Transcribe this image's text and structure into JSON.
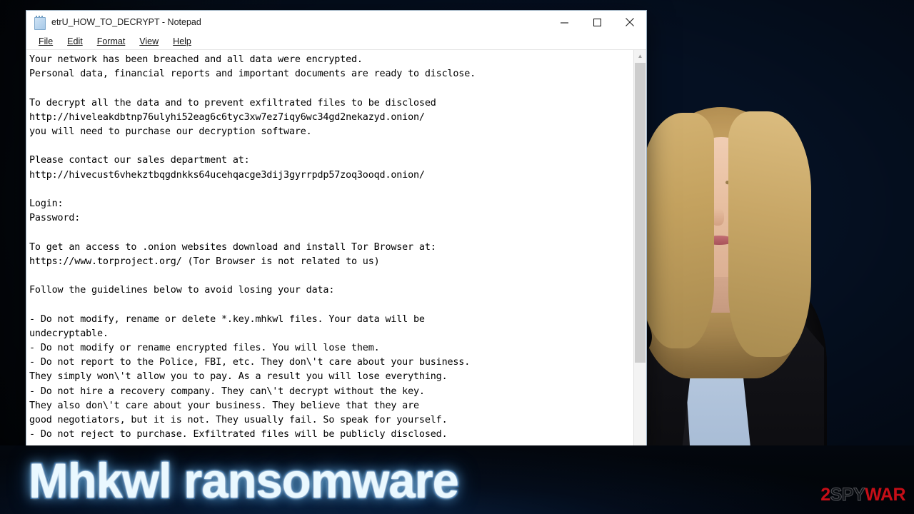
{
  "window": {
    "title": "etrU_HOW_TO_DECRYPT - Notepad",
    "icon": "notepad-icon",
    "menu": [
      {
        "label": "File",
        "accel": "F"
      },
      {
        "label": "Edit",
        "accel": "E"
      },
      {
        "label": "Format",
        "accel": "o"
      },
      {
        "label": "View",
        "accel": "V"
      },
      {
        "label": "Help",
        "accel": "H"
      }
    ],
    "controls": {
      "minimize": "minimize-button",
      "maximize": "maximize-button",
      "close": "close-button"
    },
    "note_text": "Your network has been breached and all data were encrypted.\nPersonal data, financial reports and important documents are ready to disclose.\n\nTo decrypt all the data and to prevent exfiltrated files to be disclosed\nhttp://hiveleakdbtnp76ulyhi52eag6c6tyc3xw7ez7iqy6wc34gd2nekazyd.onion/\nyou will need to purchase our decryption software.\n\nPlease contact our sales department at:\nhttp://hivecust6vhekztbqgdnkks64ucehqacge3dij3gyrrpdp57zoq3ooqd.onion/\n\nLogin:\nPassword:\n\nTo get an access to .onion websites download and install Tor Browser at:\nhttps://www.torproject.org/ (Tor Browser is not related to us)\n\nFollow the guidelines below to avoid losing your data:\n\n- Do not modify, rename or delete *.key.mhkwl files. Your data will be\nundecryptable.\n- Do not modify or rename encrypted files. You will lose them.\n- Do not report to the Police, FBI, etc. They don\\'t care about your business.\nThey simply won\\'t allow you to pay. As a result you will lose everything.\n- Do not hire a recovery company. They can\\'t decrypt without the key.\nThey also don\\'t care about your business. They believe that they are\ngood negotiators, but it is not. They usually fail. So speak for yourself.\n- Do not reject to purchase. Exfiltrated files will be publicly disclosed."
  },
  "banner": {
    "title": "Mhkwl ransomware"
  },
  "watermark": {
    "part_red_leading": "2",
    "part_gray": "SPY",
    "part_red_trailing": "WAR"
  },
  "colors": {
    "banner_text": "#eaf8ff",
    "banner_outline": "#1b4f86",
    "watermark_red": "#cc0f18",
    "background_blue": "#144a8c",
    "background_dark": "#03070f"
  }
}
